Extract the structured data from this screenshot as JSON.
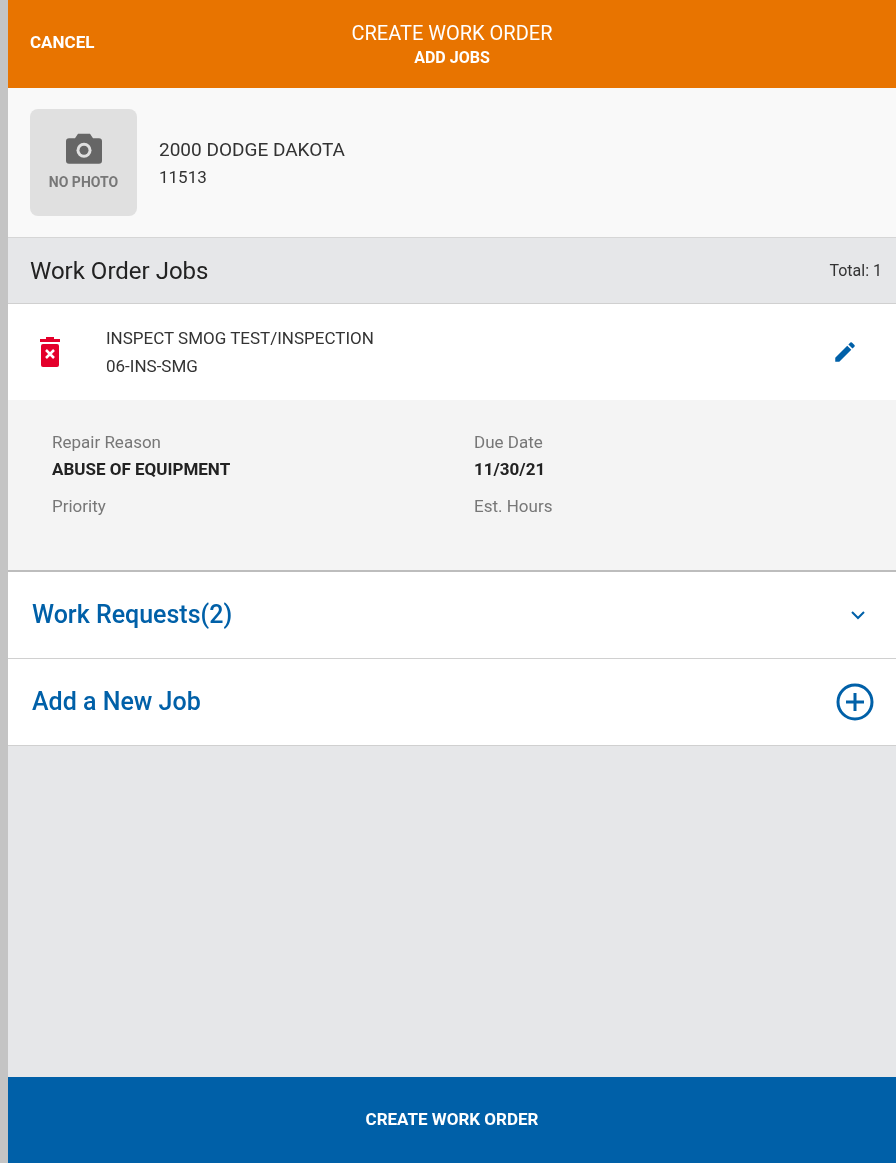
{
  "header": {
    "cancel": "CANCEL",
    "title": "CREATE WORK ORDER",
    "subtitle": "ADD JOBS"
  },
  "vehicle": {
    "photo_label": "NO PHOTO",
    "name": "2000 DODGE DAKOTA",
    "number": "11513"
  },
  "jobs_section": {
    "title": "Work Order Jobs",
    "total": "Total: 1"
  },
  "jobs": [
    {
      "title": "INSPECT SMOG TEST/INSPECTION",
      "code": "06-INS-SMG",
      "details": [
        {
          "label": "Repair Reason",
          "value": "ABUSE OF EQUIPMENT"
        },
        {
          "label": "Due Date",
          "value": "11/30/21"
        },
        {
          "label": "Priority"
        },
        {
          "label": "Est. Hours"
        }
      ]
    }
  ],
  "actions": [
    {
      "kind": "expand",
      "label": "Work Requests(2)",
      "expanded": false
    },
    {
      "kind": "add",
      "label": "Add a New Job"
    }
  ],
  "footer_button": "CREATE WORK ORDER"
}
